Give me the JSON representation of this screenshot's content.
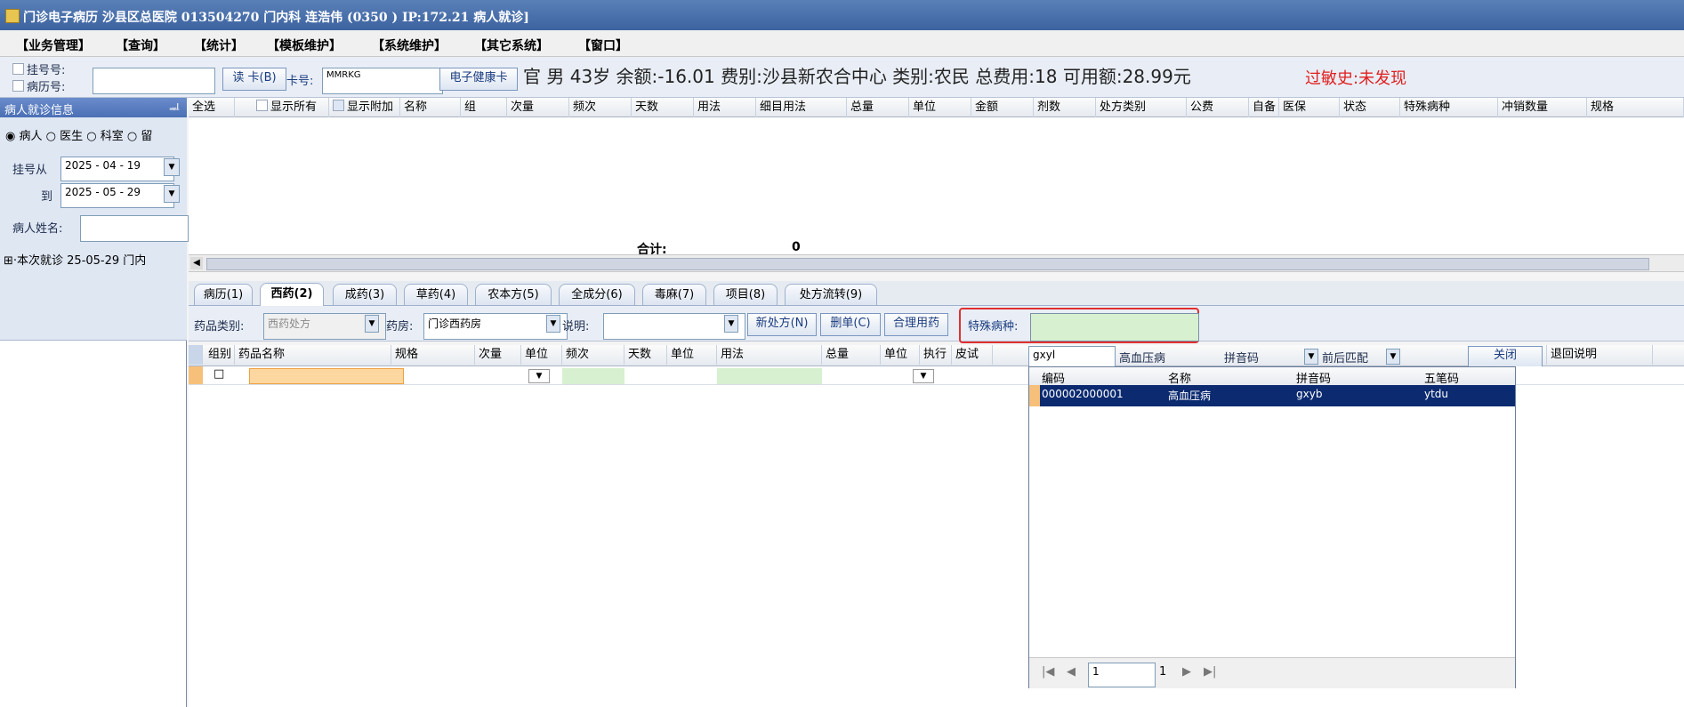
{
  "window": {
    "title": "门诊电子病历   沙县区总医院 013504270          门内科   连浩伟 (0350           )   IP:172.21                  病人就诊]"
  },
  "menu": [
    "【业务管理】",
    "【查询】",
    "【统计】",
    "【模板维护】",
    "【系统维护】",
    "【其它系统】",
    "【窗口】"
  ],
  "info": {
    "reg_label": "挂号号:",
    "record_label": "病历号:",
    "read_card_button": "读 卡(B)",
    "card_no_label": "卡号:",
    "card_no_value": "MMRKG",
    "health_card_button": "电子健康卡",
    "patient_summary": "官     男  43岁  余额:-16.01  费别:沙县新农合中心  类别:农民  总费用:18  可用额:28.99元",
    "allergy": "过敏史:未发现"
  },
  "left_panel": {
    "title": "病人就诊信息",
    "pin": "ᆗ",
    "radios": [
      "病人",
      "医生",
      "科室",
      "留"
    ],
    "reg_from_label": "挂号从",
    "reg_from_value": "2025 - 04 - 19",
    "to_label": "到",
    "to_value": "2025 - 05 - 29",
    "name_label": "病人姓名:",
    "name_value": "",
    "tree_item": "⊞·本次就诊 25-05-29 门内"
  },
  "top_grid": {
    "headers": [
      "全选",
      "显示所有",
      "显示附加",
      "名称",
      "组",
      "次量",
      "频次",
      "天数",
      "用法",
      "细目用法",
      "总量",
      "单位",
      "金额",
      "剂数",
      "处方类别",
      "公费",
      "自备",
      "医保",
      "状态",
      "特殊病种",
      "冲销数量",
      "规格"
    ],
    "total_label": "合计:",
    "total_value": "0"
  },
  "tabs": [
    "病历(1)",
    "西药(2)",
    "成药(3)",
    "草药(4)",
    "农本方(5)",
    "全成分(6)",
    "毒麻(7)",
    "项目(8)",
    "处方流转(9)"
  ],
  "toolbar": {
    "drug_type_label": "药品类别:",
    "drug_type_value": "西药处方",
    "pharmacy_label": "药房:",
    "pharmacy_value": "门诊西药房",
    "note_label": "说明:",
    "note_value": "",
    "new_rx_button": "新处方(N)",
    "delete_button": "删单(C)",
    "rational_button": "合理用药",
    "special_label": "特殊病种:",
    "special_value": ""
  },
  "lower_grid": {
    "headers": [
      "组别",
      "药品名称",
      "规格",
      "次量",
      "单位",
      "频次",
      "天数",
      "单位",
      "用法",
      "总量",
      "单位",
      "执行",
      "皮试"
    ],
    "row_checkbox": "□"
  },
  "lookup": {
    "query": "gxyl",
    "selected_name": "高血压病",
    "mode": "拼音码",
    "match": "前后匹配",
    "close_button": "关闭",
    "return_note": "退回说明",
    "columns": [
      "编码",
      "名称",
      "拼音码",
      "五笔码"
    ],
    "rows": [
      [
        "000002000001",
        "高血压病",
        "gxyb",
        "ytdu"
      ]
    ],
    "page_value": "1",
    "page_total": "1"
  },
  "colors": {
    "accent": "#3d63a0",
    "highlight": "#0b2a70",
    "alert": "#e02020",
    "callout": "#e03030"
  }
}
